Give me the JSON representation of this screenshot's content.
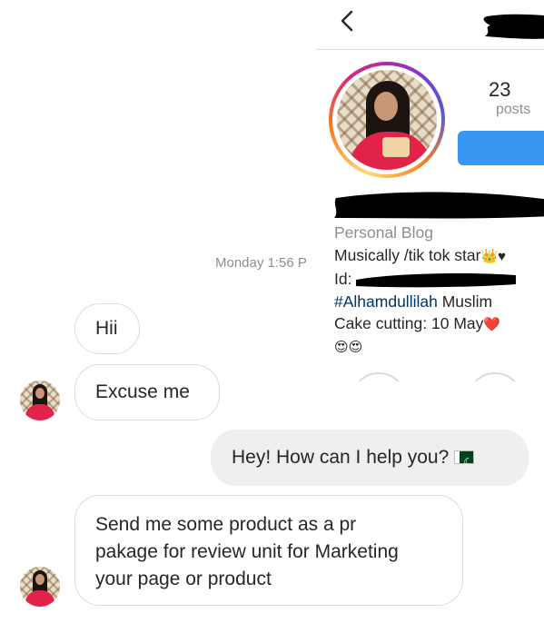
{
  "profile": {
    "back_icon": "chevron-left-icon",
    "stats": {
      "posts_count": "23",
      "posts_label": "posts"
    },
    "bio": {
      "category": "Personal Blog",
      "line_musically": "Musically /tik tok star",
      "line_id_prefix": "Id: ",
      "hashtag": "#Alhamdullilah",
      "muslim": " Muslim",
      "cake": "Cake cutting: 10 May",
      "emojis": "😍😍",
      "crown_emoji": "👑",
      "black_heart": "♥",
      "red_heart": "❤️"
    },
    "colors": {
      "follow_button": "#3897f0",
      "hashtag": "#003569",
      "muted": "#8e8e8e"
    }
  },
  "chat": {
    "timestamp": "Monday 1:56 P",
    "messages": [
      {
        "from": "them",
        "text": "Hii"
      },
      {
        "from": "them",
        "text": "Excuse me"
      },
      {
        "from": "me",
        "text": "Hey! How can I help you?",
        "flag": "pakistan-flag-icon"
      },
      {
        "from": "them",
        "lines": [
          "Send me some product as a pr",
          "pakage for review unit for Marketing",
          "your page or product"
        ]
      }
    ],
    "colors": {
      "outgoing_bubble": "#efefef",
      "incoming_border": "#dbdbdb"
    }
  }
}
